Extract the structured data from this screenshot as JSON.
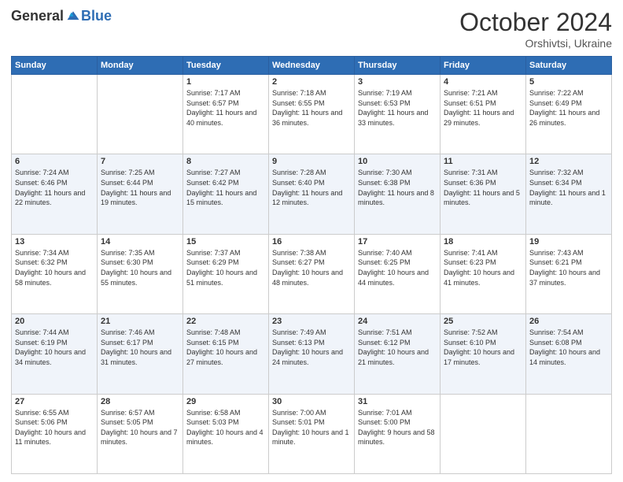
{
  "header": {
    "logo_general": "General",
    "logo_blue": "Blue",
    "month": "October 2024",
    "location": "Orshivtsi, Ukraine"
  },
  "days_of_week": [
    "Sunday",
    "Monday",
    "Tuesday",
    "Wednesday",
    "Thursday",
    "Friday",
    "Saturday"
  ],
  "weeks": [
    [
      {
        "day": "",
        "info": ""
      },
      {
        "day": "",
        "info": ""
      },
      {
        "day": "1",
        "info": "Sunrise: 7:17 AM\nSunset: 6:57 PM\nDaylight: 11 hours and 40 minutes."
      },
      {
        "day": "2",
        "info": "Sunrise: 7:18 AM\nSunset: 6:55 PM\nDaylight: 11 hours and 36 minutes."
      },
      {
        "day": "3",
        "info": "Sunrise: 7:19 AM\nSunset: 6:53 PM\nDaylight: 11 hours and 33 minutes."
      },
      {
        "day": "4",
        "info": "Sunrise: 7:21 AM\nSunset: 6:51 PM\nDaylight: 11 hours and 29 minutes."
      },
      {
        "day": "5",
        "info": "Sunrise: 7:22 AM\nSunset: 6:49 PM\nDaylight: 11 hours and 26 minutes."
      }
    ],
    [
      {
        "day": "6",
        "info": "Sunrise: 7:24 AM\nSunset: 6:46 PM\nDaylight: 11 hours and 22 minutes."
      },
      {
        "day": "7",
        "info": "Sunrise: 7:25 AM\nSunset: 6:44 PM\nDaylight: 11 hours and 19 minutes."
      },
      {
        "day": "8",
        "info": "Sunrise: 7:27 AM\nSunset: 6:42 PM\nDaylight: 11 hours and 15 minutes."
      },
      {
        "day": "9",
        "info": "Sunrise: 7:28 AM\nSunset: 6:40 PM\nDaylight: 11 hours and 12 minutes."
      },
      {
        "day": "10",
        "info": "Sunrise: 7:30 AM\nSunset: 6:38 PM\nDaylight: 11 hours and 8 minutes."
      },
      {
        "day": "11",
        "info": "Sunrise: 7:31 AM\nSunset: 6:36 PM\nDaylight: 11 hours and 5 minutes."
      },
      {
        "day": "12",
        "info": "Sunrise: 7:32 AM\nSunset: 6:34 PM\nDaylight: 11 hours and 1 minute."
      }
    ],
    [
      {
        "day": "13",
        "info": "Sunrise: 7:34 AM\nSunset: 6:32 PM\nDaylight: 10 hours and 58 minutes."
      },
      {
        "day": "14",
        "info": "Sunrise: 7:35 AM\nSunset: 6:30 PM\nDaylight: 10 hours and 55 minutes."
      },
      {
        "day": "15",
        "info": "Sunrise: 7:37 AM\nSunset: 6:29 PM\nDaylight: 10 hours and 51 minutes."
      },
      {
        "day": "16",
        "info": "Sunrise: 7:38 AM\nSunset: 6:27 PM\nDaylight: 10 hours and 48 minutes."
      },
      {
        "day": "17",
        "info": "Sunrise: 7:40 AM\nSunset: 6:25 PM\nDaylight: 10 hours and 44 minutes."
      },
      {
        "day": "18",
        "info": "Sunrise: 7:41 AM\nSunset: 6:23 PM\nDaylight: 10 hours and 41 minutes."
      },
      {
        "day": "19",
        "info": "Sunrise: 7:43 AM\nSunset: 6:21 PM\nDaylight: 10 hours and 37 minutes."
      }
    ],
    [
      {
        "day": "20",
        "info": "Sunrise: 7:44 AM\nSunset: 6:19 PM\nDaylight: 10 hours and 34 minutes."
      },
      {
        "day": "21",
        "info": "Sunrise: 7:46 AM\nSunset: 6:17 PM\nDaylight: 10 hours and 31 minutes."
      },
      {
        "day": "22",
        "info": "Sunrise: 7:48 AM\nSunset: 6:15 PM\nDaylight: 10 hours and 27 minutes."
      },
      {
        "day": "23",
        "info": "Sunrise: 7:49 AM\nSunset: 6:13 PM\nDaylight: 10 hours and 24 minutes."
      },
      {
        "day": "24",
        "info": "Sunrise: 7:51 AM\nSunset: 6:12 PM\nDaylight: 10 hours and 21 minutes."
      },
      {
        "day": "25",
        "info": "Sunrise: 7:52 AM\nSunset: 6:10 PM\nDaylight: 10 hours and 17 minutes."
      },
      {
        "day": "26",
        "info": "Sunrise: 7:54 AM\nSunset: 6:08 PM\nDaylight: 10 hours and 14 minutes."
      }
    ],
    [
      {
        "day": "27",
        "info": "Sunrise: 6:55 AM\nSunset: 5:06 PM\nDaylight: 10 hours and 11 minutes."
      },
      {
        "day": "28",
        "info": "Sunrise: 6:57 AM\nSunset: 5:05 PM\nDaylight: 10 hours and 7 minutes."
      },
      {
        "day": "29",
        "info": "Sunrise: 6:58 AM\nSunset: 5:03 PM\nDaylight: 10 hours and 4 minutes."
      },
      {
        "day": "30",
        "info": "Sunrise: 7:00 AM\nSunset: 5:01 PM\nDaylight: 10 hours and 1 minute."
      },
      {
        "day": "31",
        "info": "Sunrise: 7:01 AM\nSunset: 5:00 PM\nDaylight: 9 hours and 58 minutes."
      },
      {
        "day": "",
        "info": ""
      },
      {
        "day": "",
        "info": ""
      }
    ]
  ]
}
